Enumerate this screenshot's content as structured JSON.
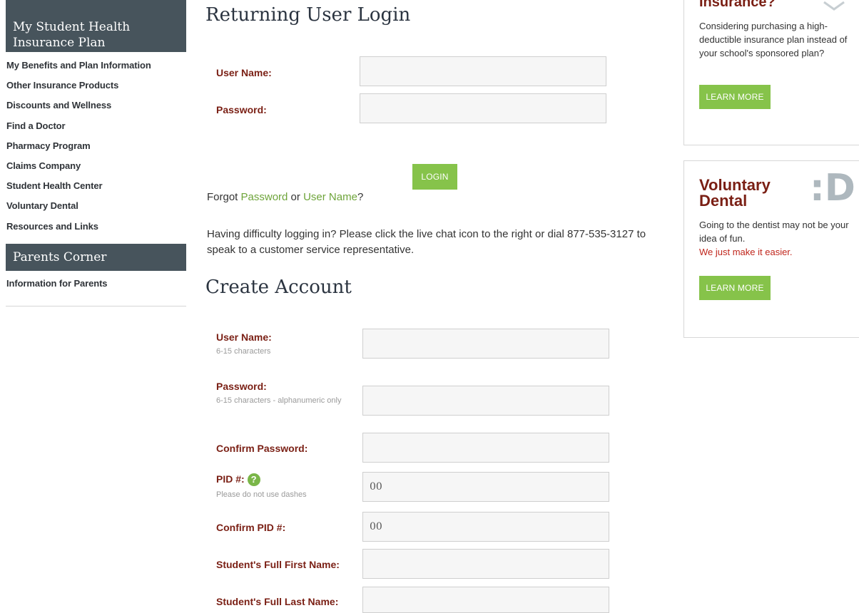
{
  "sidebar": {
    "section1_title": "My Student Health Insurance Plan",
    "items": [
      {
        "label": "My Benefits and Plan Information"
      },
      {
        "label": "Other Insurance Products"
      },
      {
        "label": "Discounts and Wellness"
      },
      {
        "label": "Find a Doctor"
      },
      {
        "label": "Pharmacy Program"
      },
      {
        "label": "Claims Company"
      },
      {
        "label": "Student Health Center"
      },
      {
        "label": "Voluntary Dental"
      },
      {
        "label": "Resources and Links"
      }
    ],
    "section2_title": "Parents Corner",
    "items2": [
      {
        "label": "Information for Parents"
      }
    ]
  },
  "login": {
    "title": "Returning User Login",
    "username_label": "User Name:",
    "password_label": "Password:",
    "login_button": "LOGIN",
    "forgot_prefix": "Forgot ",
    "forgot_password_link": "Password",
    "forgot_or": " or ",
    "forgot_username_link": "User Name",
    "forgot_suffix": "?",
    "help_text": "Having difficulty logging in? Please click the live chat icon to the right or dial 877-535-3127 to speak to a customer service representative."
  },
  "create": {
    "title": "Create Account",
    "username_label": "User Name:",
    "username_hint": "6-15 characters",
    "password_label": "Password:",
    "password_hint": "6-15 characters - alphanumeric only",
    "confirm_password_label": "Confirm Password:",
    "pid_label": "PID #:",
    "pid_help": "?",
    "pid_hint": "Please do not use dashes",
    "pid_value": "00",
    "confirm_pid_label": "Confirm PID #:",
    "confirm_pid_value": "00",
    "first_name_label": "Student's Full First Name:",
    "last_name_label": "Student's Full Last Name:"
  },
  "promo1": {
    "title_partial": "Insurance?",
    "body": "Considering purchasing a high-deductible insurance plan instead of your school's sponsored plan?",
    "button": "LEARN MORE"
  },
  "promo2": {
    "title_line1": "Voluntary",
    "title_line2": "Dental",
    "logo": ":D",
    "body": "Going to the dentist may not be your idea of fun.",
    "accent": "We just make it easier.",
    "button": "LEARN MORE"
  },
  "colors": {
    "sidebar_header": "#47545c",
    "label_red": "#7a1f14",
    "button_green": "#86c34a",
    "link_green": "#6ea43a"
  }
}
